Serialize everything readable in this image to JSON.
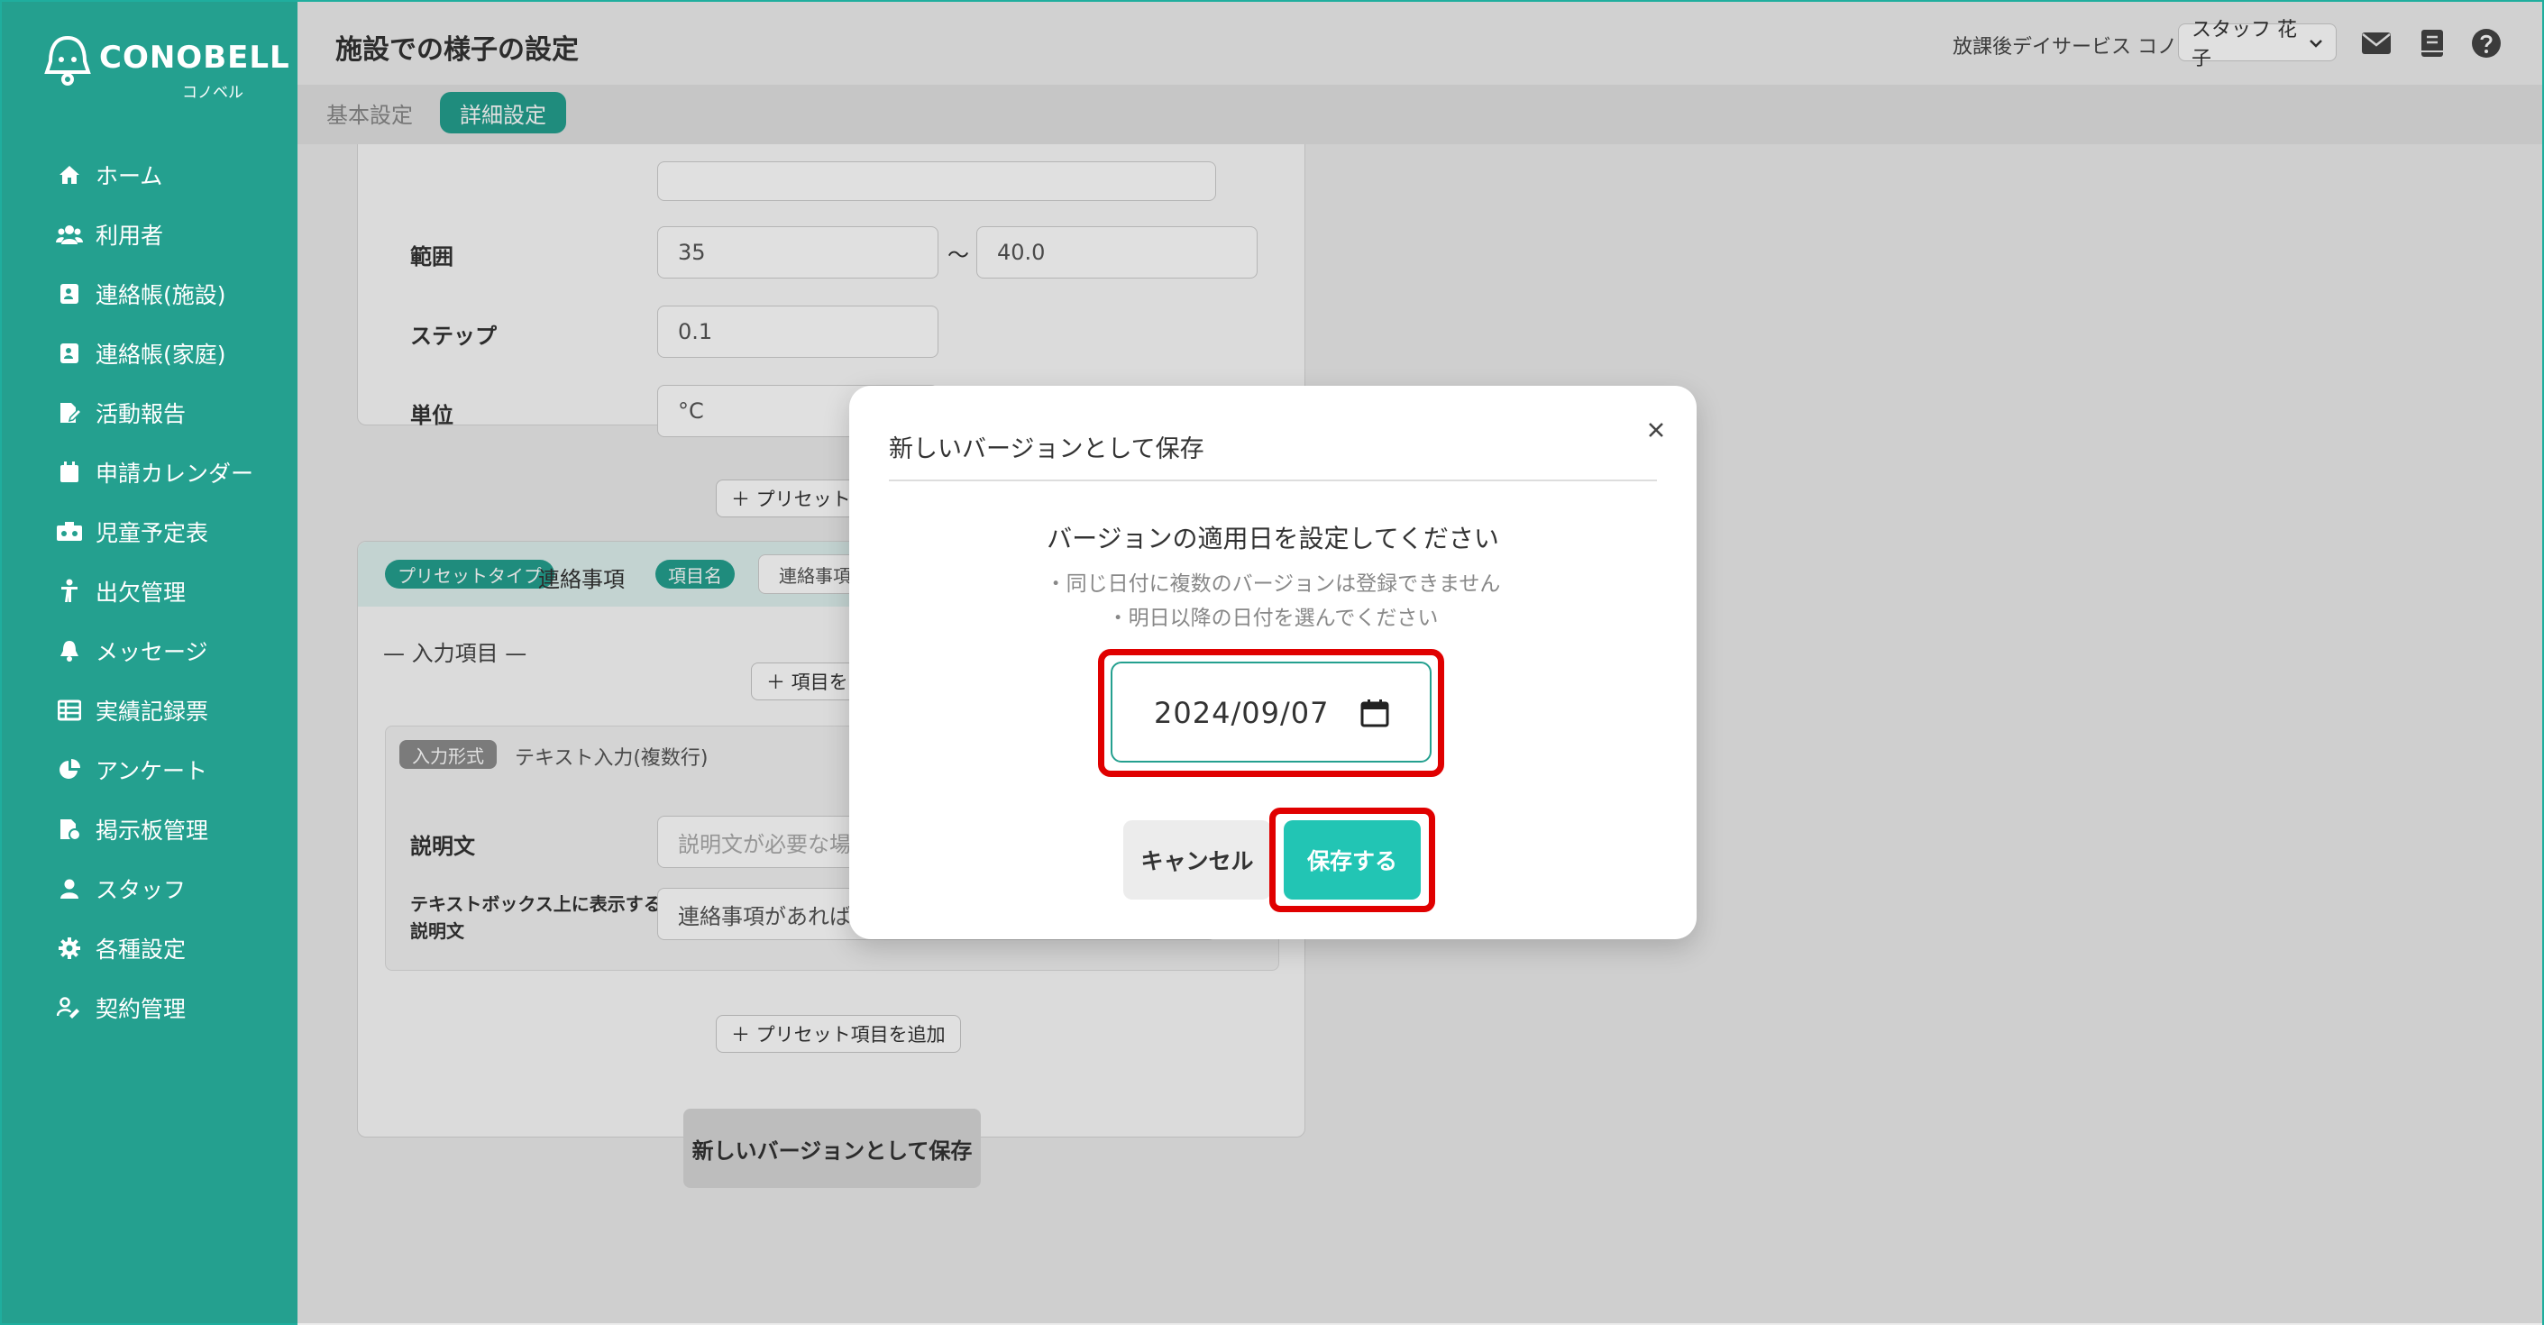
{
  "header": {
    "title": "施設での様子の設定",
    "facility": "放課後デイサービス コノベル",
    "user": "スタッフ 花子"
  },
  "logo": {
    "word": "CONOBELL",
    "sub": "コノベル"
  },
  "tabs": {
    "basic": "基本設定",
    "detail": "詳細設定"
  },
  "sidebar": {
    "items": [
      {
        "label": "ホーム",
        "icon": "home-icon"
      },
      {
        "label": "利用者",
        "icon": "users-icon"
      },
      {
        "label": "連絡帳(施設)",
        "icon": "contact-book-icon"
      },
      {
        "label": "連絡帳(家庭)",
        "icon": "contact-book-icon"
      },
      {
        "label": "活動報告",
        "icon": "report-icon"
      },
      {
        "label": "申請カレンダー",
        "icon": "calendar-icon"
      },
      {
        "label": "児童予定表",
        "icon": "schedule-icon"
      },
      {
        "label": "出欠管理",
        "icon": "attendance-icon"
      },
      {
        "label": "メッセージ",
        "icon": "bell-icon"
      },
      {
        "label": "実績記録票",
        "icon": "table-icon"
      },
      {
        "label": "アンケート",
        "icon": "pie-chart-icon"
      },
      {
        "label": "掲示板管理",
        "icon": "bulletin-icon"
      },
      {
        "label": "スタッフ",
        "icon": "staff-icon"
      },
      {
        "label": "各種設定",
        "icon": "gear-icon"
      },
      {
        "label": "契約管理",
        "icon": "contract-icon"
      }
    ]
  },
  "content": {
    "range_label": "範囲",
    "range_min": "35",
    "range_sep": "〜",
    "range_max": "40.0",
    "step_label": "ステップ",
    "step_value": "0.1",
    "unit_label": "単位",
    "unit_value": "°C",
    "preset_add_short": "＋ プリセット項",
    "preset_type_pill": "プリセットタイプ",
    "preset_type_value": "連絡事項",
    "item_name_pill": "項目名",
    "item_name_value": "連絡事項",
    "input_items_heading": "— 入力項目 —",
    "item_add_short": "＋ 項目を",
    "input_type_pill": "入力形式",
    "input_type_value": "テキスト入力(複数行)",
    "desc_label": "説明文",
    "desc_placeholder": "説明文が必要な場",
    "textbox_desc_label_1": "テキストボックス上に表示する",
    "textbox_desc_label_2": "説明文",
    "textbox_desc_value": "連絡事項があれば",
    "preset_add_full": "＋ プリセット項目を追加",
    "save_version_button": "新しいバージョンとして保存"
  },
  "modal": {
    "title": "新しいバージョンとして保存",
    "heading": "バージョンの適用日を設定してください",
    "note1": "・同じ日付に複数のバージョンは登録できません",
    "note2": "・明日以降の日付を選んでください",
    "date_value": "2024/09/07",
    "cancel_label": "キャンセル",
    "save_label": "保存する"
  },
  "colors": {
    "brand": "#24a08f",
    "accent": "#22c5b4",
    "highlight": "#e00000"
  }
}
